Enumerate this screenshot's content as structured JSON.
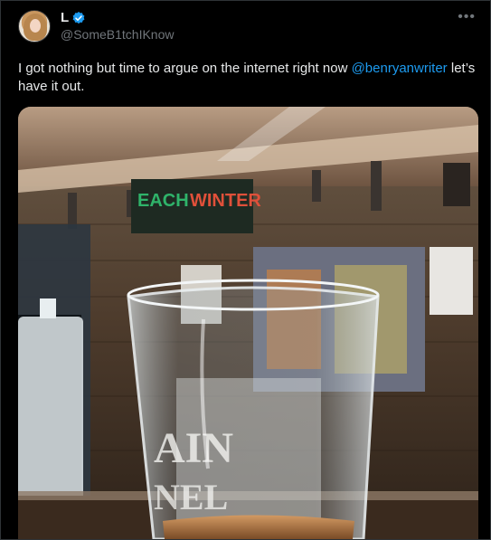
{
  "tweet": {
    "author_name": "L",
    "author_handle": "@SomeB1tchIKnow",
    "text_prefix": "I got nothing but time to argue on the internet right now ",
    "mention": "@benryanwriter",
    "text_suffix": " let’s have it out.",
    "more_icon": "ellipsis-icon"
  },
  "media": {
    "description_icon": "photo-icon",
    "glass_text_1": "AIN",
    "glass_text_2": "NEL",
    "sign_text_1": "EACH",
    "sign_text_2": "WINTER"
  },
  "colors": {
    "accent": "#1d9bf0",
    "text": "#e7e9ea",
    "muted": "#71767b",
    "background": "#000000"
  }
}
